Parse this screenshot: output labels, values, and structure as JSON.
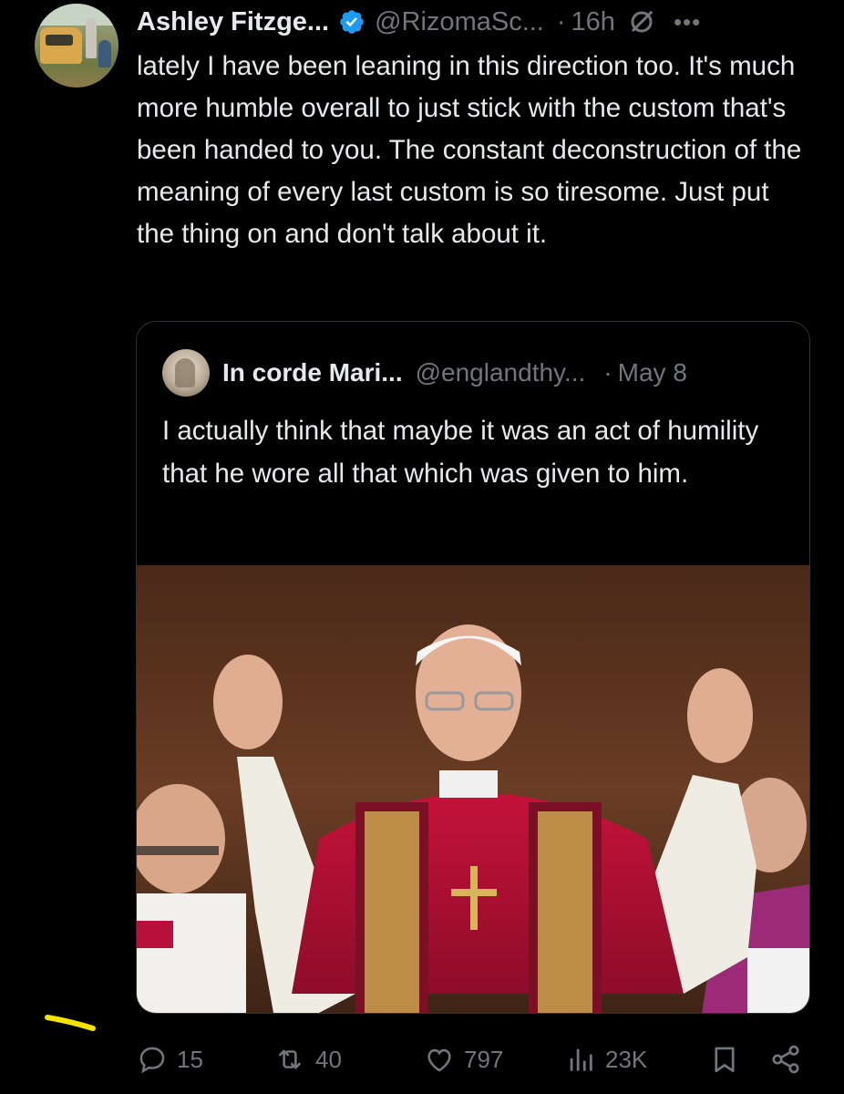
{
  "tweet": {
    "author_name": "Ashley Fitzge...",
    "author_handle": "@RizomaSc...",
    "separator": "·",
    "time": "16h",
    "text": "lately I have been leaning in this direction too. It's much more humble overall to just stick with the custom that's been handed to you. The constant deconstruction of the meaning of every last custom is so tiresome. Just put the thing on and don't talk about it."
  },
  "quoted": {
    "author_name": "In corde Mari...",
    "author_handle": "@englandthy...",
    "separator": "·",
    "time": "May 8",
    "text": "I actually think that maybe it was an act of humility that he wore all that which was given to him."
  },
  "actions": {
    "replies": "15",
    "reposts": "40",
    "likes": "797",
    "views": "23K"
  },
  "icons": {
    "verified": "verified-badge-icon",
    "grok": "grok-icon",
    "more": "more-icon",
    "reply": "reply-icon",
    "repost": "repost-icon",
    "like": "like-icon",
    "views": "views-icon",
    "bookmark": "bookmark-icon",
    "share": "share-icon"
  },
  "colors": {
    "background": "#000000",
    "text": "#e7e9ea",
    "muted": "#71767b",
    "verified": "#1d9bf0",
    "highlight": "#f5e400"
  }
}
